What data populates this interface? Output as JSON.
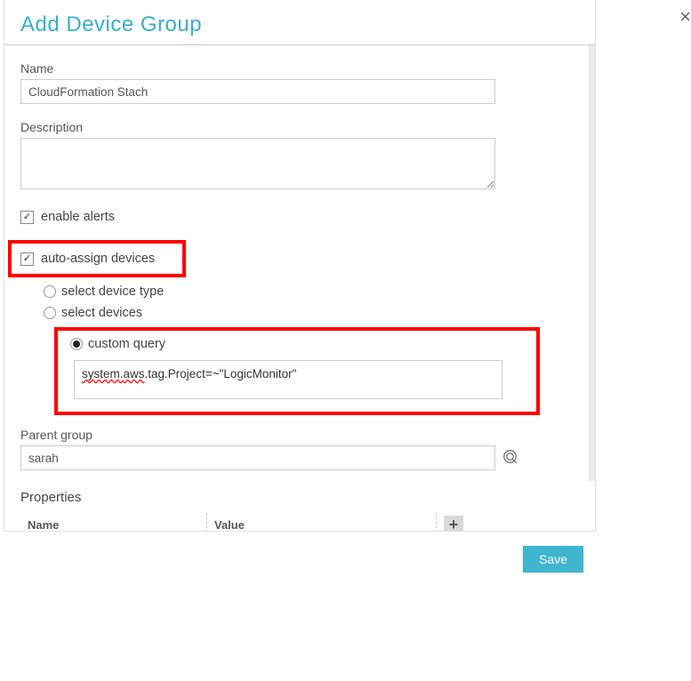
{
  "dialog": {
    "title": "Add Device Group",
    "close_label": "×"
  },
  "fields": {
    "name_label": "Name",
    "name_value": "CloudFormation Stach",
    "description_label": "Description",
    "description_value": "",
    "enable_alerts_label": "enable alerts",
    "enable_alerts_checked": "✓",
    "auto_assign_label": "auto-assign devices",
    "auto_assign_checked": "✓"
  },
  "auto_assign_options": {
    "select_device_type_label": "select device type",
    "select_devices_label": "select devices",
    "custom_query_label": "custom query",
    "custom_query_full": "system.aws.tag.Project=~\"LogicMonitor\"",
    "custom_query_part1": "system.",
    "custom_query_part2": "aws",
    "custom_query_part3": ".tag.Project=~\"LogicMonitor\""
  },
  "parent_group": {
    "label": "Parent group",
    "value": "sarah"
  },
  "properties": {
    "section_label": "Properties",
    "col_name": "Name",
    "col_value": "Value",
    "add_label": "+"
  },
  "footer": {
    "save_label": "Save"
  }
}
